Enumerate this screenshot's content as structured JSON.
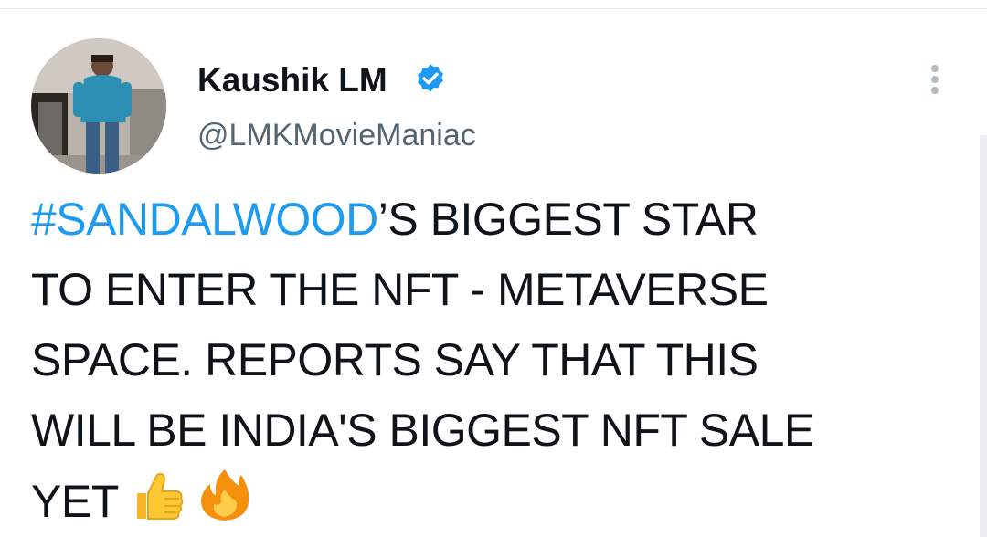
{
  "tweet": {
    "author": {
      "display_name": "Kaushik LM",
      "handle": "@LMKMovieManiac",
      "verified": true,
      "avatar_icon": "profile-photo"
    },
    "text": {
      "hashtag": "#SANDALWOOD",
      "line1_rest": "’S BIGGEST STAR",
      "line2": "TO ENTER THE NFT - METAVERSE",
      "line3": "SPACE. REPORTS SAY THAT THIS",
      "line4": "WILL BE INDIA'S BIGGEST NFT SALE",
      "line5": "YET",
      "emojis": [
        "thumbs-up-emoji",
        "fire-emoji"
      ]
    },
    "menu_icon": "more-vertical-icon"
  },
  "colors": {
    "link": "#1d9bf0",
    "text": "#0f1419",
    "secondary": "#536471",
    "verified": "#1d9bf0"
  }
}
